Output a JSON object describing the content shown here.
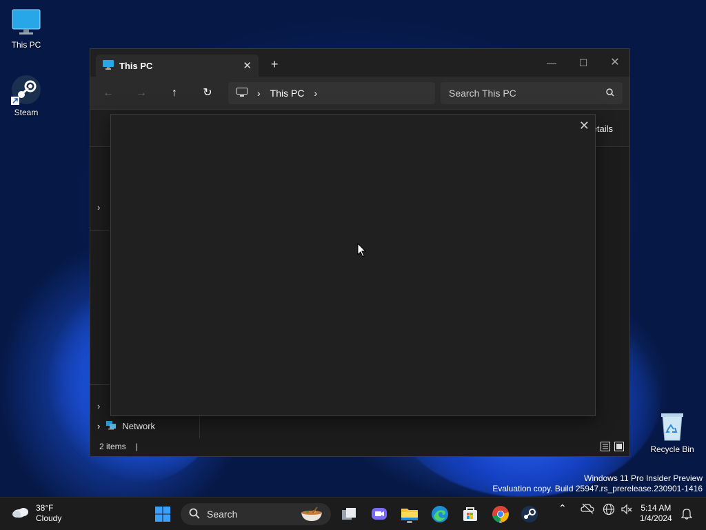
{
  "desktop": {
    "icons": [
      {
        "label": "This PC"
      },
      {
        "label": "Steam"
      },
      {
        "label": "Recycle Bin"
      }
    ]
  },
  "window": {
    "tab_title": "This PC",
    "address": {
      "crumbs": [
        "This PC"
      ]
    },
    "search_placeholder": "Search This PC",
    "command_bar": {
      "details_label": "etails"
    },
    "sidebar": {
      "network_label": "Network"
    },
    "status": {
      "items_count": "2 items",
      "separator": "|"
    }
  },
  "watermark": {
    "line1": "Windows 11 Pro Insider Preview",
    "line2": "Evaluation copy. Build 25947.rs_prerelease.230901-1416"
  },
  "taskbar": {
    "weather": {
      "temp": "38°F",
      "condition": "Cloudy"
    },
    "search_label": "Search",
    "clock": {
      "time": "5:14 AM",
      "date": "1/4/2024"
    }
  },
  "colors": {
    "accent": "#0078d4",
    "window_bg": "#1c1c1c",
    "taskbar_bg": "#1c1c1c"
  }
}
